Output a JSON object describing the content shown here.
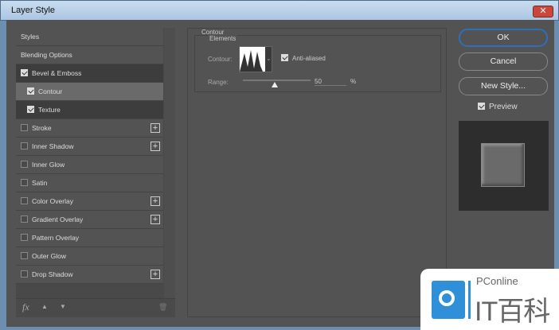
{
  "window": {
    "title": "Layer Style",
    "close": "✕"
  },
  "left": {
    "items": [
      {
        "label": "Styles"
      },
      {
        "label": "Blending Options"
      },
      {
        "label": "Bevel & Emboss",
        "checked": true
      },
      {
        "label": "Contour",
        "checked": true
      },
      {
        "label": "Texture",
        "checked": true
      },
      {
        "label": "Stroke",
        "checked": false,
        "plus": true
      },
      {
        "label": "Inner Shadow",
        "checked": false,
        "plus": true
      },
      {
        "label": "Inner Glow",
        "checked": false
      },
      {
        "label": "Satin",
        "checked": false
      },
      {
        "label": "Color Overlay",
        "checked": false,
        "plus": true
      },
      {
        "label": "Gradient Overlay",
        "checked": false,
        "plus": true
      },
      {
        "label": "Pattern Overlay",
        "checked": false
      },
      {
        "label": "Outer Glow",
        "checked": false
      },
      {
        "label": "Drop Shadow",
        "checked": false,
        "plus": true
      }
    ],
    "tools": {
      "fx": "fx",
      "up": "▲",
      "down": "▼",
      "trash": "🗑"
    }
  },
  "contour": {
    "section": "Contour",
    "group": "Elements",
    "contour_label": "Contour:",
    "anti_aliased": "Anti-aliased",
    "range_label": "Range:",
    "range_value": "50",
    "percent": "%"
  },
  "buttons": {
    "ok": "OK",
    "cancel": "Cancel",
    "new_style": "New Style...",
    "preview": "Preview"
  },
  "watermark": {
    "brand": "PConline",
    "name": "IT百科"
  }
}
